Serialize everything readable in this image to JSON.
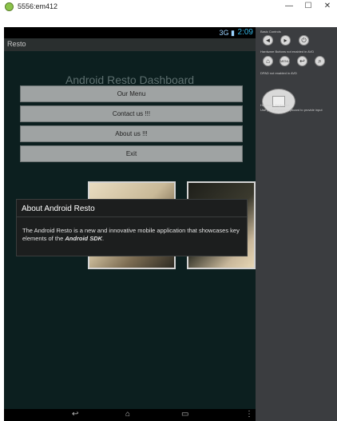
{
  "window": {
    "title": "5556:em412",
    "minimize": "—",
    "maximize": "☐",
    "close": "✕"
  },
  "status_bar": {
    "time": "2:09",
    "icons": "3G ▮"
  },
  "action_bar": {
    "title": "Resto"
  },
  "dashboard": {
    "title": "Android Resto Dashboard",
    "buttons": [
      "Our Menu",
      "Contact us !!!",
      "About us !!!",
      "Exit"
    ]
  },
  "dialog": {
    "title": "About Android Resto",
    "body_prefix": " The Android Resto is a new and innovative mobile application that showcases key elements of the ",
    "body_emphasis": "Android SDK",
    "body_suffix": "."
  },
  "nav_bar": {
    "back": "↩",
    "home": "⌂",
    "recents": "▭",
    "menu": "⋮"
  },
  "controls": {
    "basic_label": "Basic Controls",
    "hardware_label": "Hardware Buttons not enabled in AVD",
    "dpad_label": "DPAD not enabled in AVD",
    "keyboard_label": "Hardware Keyboard",
    "keyboard_hint": "Use your physical keyboard to provide input",
    "basic": [
      "◄",
      "▸",
      "⏻"
    ],
    "hardware": [
      "⌂",
      "MENU",
      "↩",
      "⌕"
    ],
    "dpad_center": "OK"
  }
}
